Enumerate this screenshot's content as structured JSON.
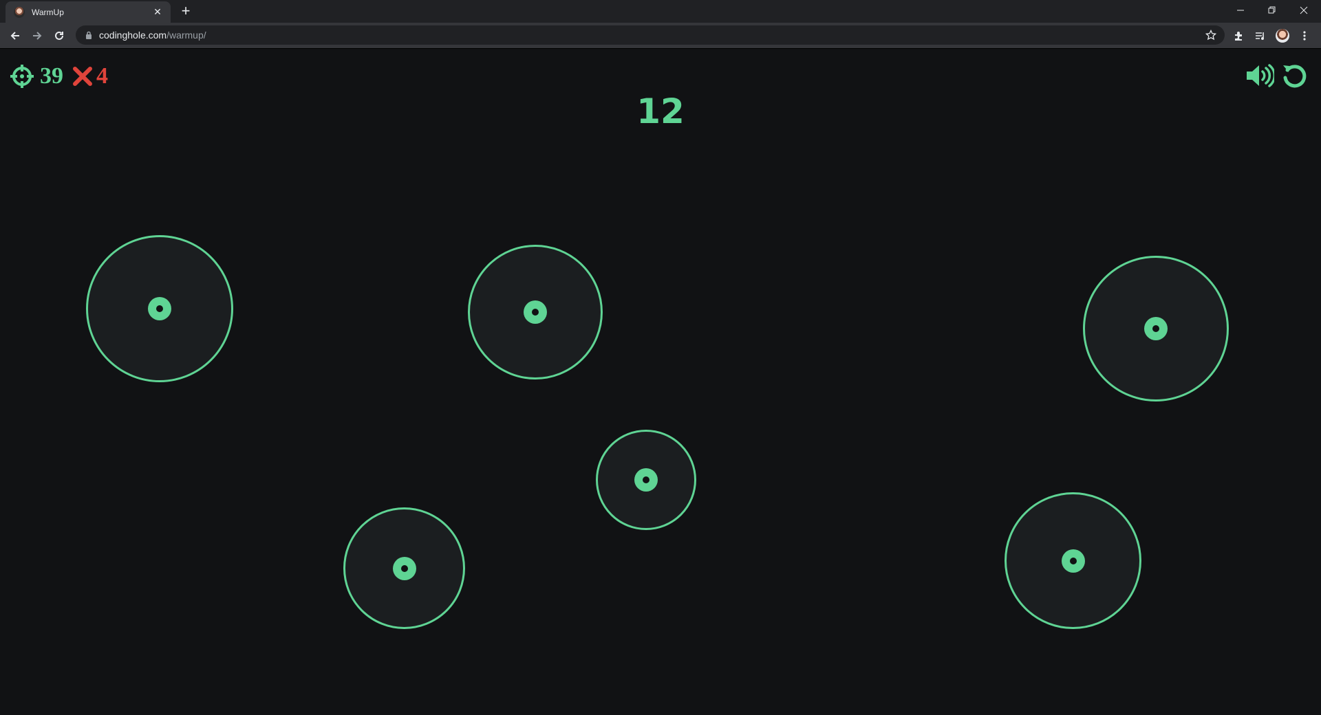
{
  "browser": {
    "tab_title": "WarmUp",
    "url_domain": "codinghole.com",
    "url_path": "/warmup/"
  },
  "hud": {
    "hits": "39",
    "misses": "4",
    "timer": "12",
    "colors": {
      "accent": "#5fd494",
      "miss": "#e0443b",
      "background": "#111214",
      "target_fill": "#1b1e20"
    },
    "icons": [
      "crosshair-icon",
      "x-icon",
      "volume-icon",
      "restart-icon"
    ]
  },
  "game": {
    "target_count": 6
  }
}
